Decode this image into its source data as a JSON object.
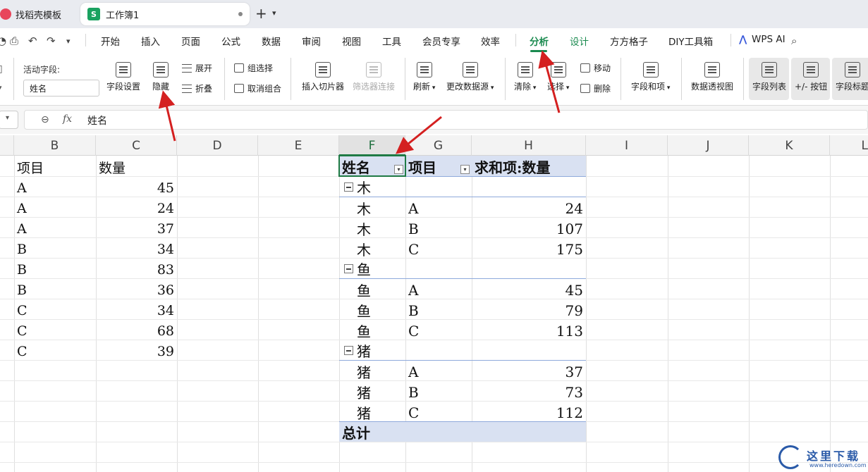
{
  "tabs": {
    "inactive_label": "找稻壳模板",
    "active_label": "工作簿1",
    "doc_badge": "S"
  },
  "menu": {
    "items": [
      "开始",
      "插入",
      "页面",
      "公式",
      "数据",
      "审阅",
      "视图",
      "工具",
      "会员专享",
      "效率"
    ],
    "analyze": "分析",
    "design": "设计",
    "fangfang": "方方格子",
    "diy": "DIY工具箱",
    "wpsai": "WPS AI"
  },
  "ribbon": {
    "active_field_label": "活动字段:",
    "active_field_value": "姓名",
    "field_settings": "字段设置",
    "hide": "隐藏",
    "expand": "展开",
    "collapse": "折叠",
    "group_selection": "组选择",
    "ungroup": "取消组合",
    "insert_slicer": "插入切片器",
    "filter_connections": "筛选器连接",
    "refresh": "刷新",
    "change_source": "更改数据源",
    "clear": "清除",
    "select": "选择",
    "move": "移动",
    "delete": "删除",
    "fields_items": "字段和项",
    "pivot_table": "数据透视图",
    "field_list": "字段列表",
    "plus_minus_buttons": "+/- 按钮",
    "field_headers": "字段标题"
  },
  "formula_bar": {
    "fx": "fx",
    "value": "姓名"
  },
  "columns": [
    "B",
    "C",
    "D",
    "E",
    "F",
    "G",
    "H",
    "I",
    "J",
    "K",
    "L"
  ],
  "source_table": {
    "headers": [
      "项目",
      "数量"
    ],
    "rows": [
      [
        "A",
        "45"
      ],
      [
        "A",
        "24"
      ],
      [
        "A",
        "37"
      ],
      [
        "B",
        "34"
      ],
      [
        "B",
        "83"
      ],
      [
        "B",
        "36"
      ],
      [
        "C",
        "34"
      ],
      [
        "C",
        "68"
      ],
      [
        "C",
        "39"
      ]
    ]
  },
  "pivot": {
    "headers": [
      "姓名",
      "项目",
      "求和项:数量"
    ],
    "groups": [
      {
        "name": "木",
        "rows": [
          [
            "木",
            "A",
            "24"
          ],
          [
            "木",
            "B",
            "107"
          ],
          [
            "木",
            "C",
            "175"
          ]
        ]
      },
      {
        "name": "鱼",
        "rows": [
          [
            "鱼",
            "A",
            "45"
          ],
          [
            "鱼",
            "B",
            "79"
          ],
          [
            "鱼",
            "C",
            "113"
          ]
        ]
      },
      {
        "name": "猪",
        "rows": [
          [
            "猪",
            "A",
            "37"
          ],
          [
            "猪",
            "B",
            "73"
          ],
          [
            "猪",
            "C",
            "112"
          ]
        ]
      }
    ],
    "total_label": "总计"
  },
  "watermark": {
    "text": "这里下载",
    "url": "www.heredown.com"
  },
  "colors": {
    "accent": "#1a8a4f",
    "pivot_header_bg": "#d9e1f2",
    "arrow": "#d42020"
  }
}
